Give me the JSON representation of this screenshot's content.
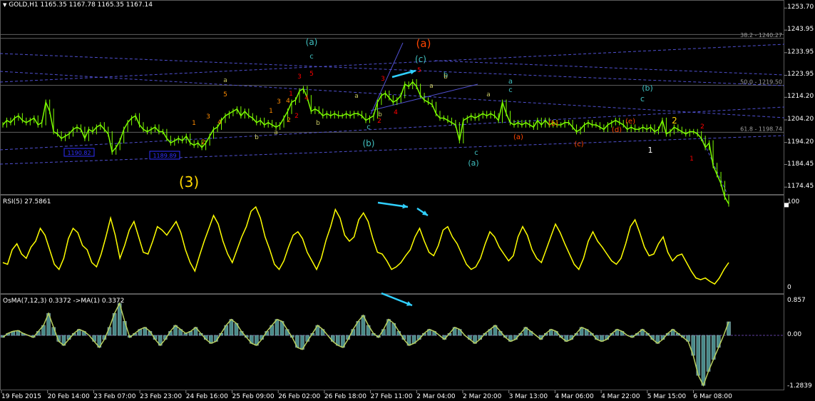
{
  "header": {
    "symbol": "GOLD,H1",
    "ohlc": "1165.35 1167.78 1165.35 1167.14",
    "rsi_label": "RSI(5) 27.5861",
    "osma_label": "OsMA(7,12,3) 0.3372 ->MA(1) 0.3372"
  },
  "chart_data": [
    {
      "type": "line",
      "title": "GOLD,H1",
      "ylim": [
        1172.0,
        1256.0
      ],
      "y_ticks": [
        "1253.70",
        "1243.95",
        "1233.95",
        "1223.95",
        "1214.20",
        "1204.20",
        "1194.20",
        "1184.45",
        "1174.45"
      ],
      "x_ticks": [
        "19 Feb 2015",
        "20 Feb 14:00",
        "23 Feb 07:00",
        "23 Feb 23:00",
        "24 Feb 16:00",
        "25 Feb 09:00",
        "26 Feb 02:00",
        "26 Feb 18:00",
        "27 Feb 11:00",
        "2 Mar 04:00",
        "2 Mar 20:00",
        "3 Mar 13:00",
        "4 Mar 06:00",
        "4 Mar 22:00",
        "5 Mar 15:00",
        "6 Mar 08:00"
      ],
      "series": [
        {
          "values": [
            1202,
            1204,
            1203,
            1205,
            1206,
            1204,
            1203,
            1204,
            1205,
            1202,
            1203,
            1212,
            1208,
            1199,
            1198,
            1196,
            1197,
            1198,
            1200,
            1201,
            1200,
            1196,
            1200,
            1199,
            1201,
            1202,
            1200,
            1198,
            1190,
            1192,
            1195,
            1200,
            1203,
            1205,
            1206,
            1202,
            1200,
            1199,
            1200,
            1201,
            1199,
            1199,
            1196,
            1194,
            1195,
            1196,
            1195,
            1197,
            1194,
            1193,
            1194,
            1192,
            1194,
            1197,
            1200,
            1201,
            1204,
            1206,
            1207,
            1208,
            1209,
            1206,
            1208,
            1206,
            1205,
            1203,
            1204,
            1202,
            1203,
            1202,
            1201,
            1202,
            1205,
            1208,
            1212,
            1213,
            1217,
            1218,
            1214,
            1208,
            1209,
            1208,
            1206,
            1207,
            1206,
            1207,
            1206,
            1206,
            1207,
            1206,
            1207,
            1207,
            1206,
            1204,
            1205,
            1206,
            1212,
            1215,
            1216,
            1214,
            1212,
            1213,
            1215,
            1220,
            1219,
            1221,
            1219,
            1215,
            1213,
            1212,
            1211,
            1207,
            1205,
            1205,
            1204,
            1203,
            1202,
            1195,
            1204,
            1205,
            1206,
            1205,
            1206,
            1207,
            1206,
            1207,
            1206,
            1204,
            1212,
            1207,
            1203,
            1202,
            1203,
            1202,
            1203,
            1202,
            1201,
            1204,
            1202,
            1204,
            1202,
            1203,
            1202,
            1202,
            1203,
            1203,
            1201,
            1199,
            1200,
            1202,
            1203,
            1202,
            1202,
            1201,
            1200,
            1202,
            1203,
            1204,
            1203,
            1202,
            1200,
            1201,
            1200,
            1200,
            1201,
            1200,
            1201,
            1199,
            1200,
            1204,
            1198,
            1199,
            1201,
            1200,
            1199,
            1198,
            1199,
            1199,
            1198,
            1196,
            1192,
            1194,
            1184,
            1180,
            1176,
            1170,
            1167
          ],
          "color": "#7cfc00"
        }
      ],
      "levels": [
        {
          "label": "38.2 - 1240.27",
          "value": 1240.27
        },
        {
          "label": "50.0 - 1219.50",
          "value": 1219.5
        },
        {
          "label": "61.8 - 1198.74",
          "value": 1198.74
        }
      ],
      "price_tags": [
        "1190.82",
        "1189.89"
      ],
      "wave_labels": [
        {
          "text": "(3)",
          "color": "#ffd700"
        },
        {
          "text": "(a)",
          "color": "#ff4500"
        },
        {
          "text": "(a)",
          "color": "#40c0c0"
        },
        {
          "text": "(c)",
          "color": "#40c0c0"
        },
        {
          "text": "(b)",
          "color": "#40c0c0"
        },
        {
          "text": "(a)",
          "color": "#40c0c0"
        },
        {
          "text": "(b)",
          "color": "#40c0c0"
        },
        {
          "text": "a",
          "color": "#40c0c0"
        },
        {
          "text": "c",
          "color": "#40c0c0"
        },
        {
          "text": "c",
          "color": "#40c0c0"
        },
        {
          "text": "c",
          "color": "#40c0c0"
        },
        {
          "text": "c",
          "color": "#40c0c0"
        },
        {
          "text": "c",
          "color": "#40c0c0"
        },
        {
          "text": "b",
          "color": "#40c0c0"
        },
        {
          "text": "(b)",
          "color": "#ff4500"
        },
        {
          "text": "(d)",
          "color": "#ff4500"
        },
        {
          "text": "(a)",
          "color": "#ff4500"
        },
        {
          "text": "(c)",
          "color": "#ff4500"
        },
        {
          "text": "(e)",
          "color": "#ff4500"
        },
        {
          "text": "1",
          "color": "#ffffff"
        },
        {
          "text": "2",
          "color": "#ffd700"
        },
        {
          "text": "2",
          "color": "#ff0000"
        },
        {
          "text": "1",
          "color": "#ff0000"
        },
        {
          "text": "1",
          "color": "#ff8c00"
        },
        {
          "text": "2",
          "color": "#ff8c00"
        },
        {
          "text": "3",
          "color": "#ff8c00"
        },
        {
          "text": "4",
          "color": "#ff8c00"
        },
        {
          "text": "5",
          "color": "#ff8c00"
        },
        {
          "text": "1",
          "color": "#ff8c00"
        },
        {
          "text": "2",
          "color": "#ff8c00"
        },
        {
          "text": "3",
          "color": "#ff8c00"
        },
        {
          "text": "4",
          "color": "#ff8c00"
        },
        {
          "text": "1",
          "color": "#ff0000"
        },
        {
          "text": "2",
          "color": "#ff0000"
        },
        {
          "text": "3",
          "color": "#ff0000"
        },
        {
          "text": "4",
          "color": "#ff0000"
        },
        {
          "text": "5",
          "color": "#ff0000"
        },
        {
          "text": "2",
          "color": "#ff0000"
        },
        {
          "text": "3",
          "color": "#ff0000"
        },
        {
          "text": "4",
          "color": "#ff0000"
        },
        {
          "text": "5",
          "color": "#ff0000"
        },
        {
          "text": "a",
          "color": "#c8c864"
        },
        {
          "text": "b",
          "color": "#c8c864"
        },
        {
          "text": "a",
          "color": "#c8c864"
        },
        {
          "text": "b",
          "color": "#c8c864"
        },
        {
          "text": "a",
          "color": "#c8c864"
        },
        {
          "text": "b",
          "color": "#c8c864"
        },
        {
          "text": "a",
          "color": "#c8c864"
        },
        {
          "text": "b",
          "color": "#c8c864"
        },
        {
          "text": "a",
          "color": "#c8c864"
        }
      ]
    },
    {
      "type": "line",
      "title": "RSI(5) 27.5861",
      "ylim": [
        0,
        100
      ],
      "y_ticks": [
        "100",
        "0"
      ],
      "series": [
        {
          "values": [
            30,
            28,
            45,
            52,
            40,
            35,
            48,
            55,
            70,
            62,
            45,
            28,
            22,
            35,
            58,
            70,
            65,
            50,
            45,
            30,
            25,
            40,
            60,
            82,
            62,
            35,
            50,
            68,
            78,
            60,
            42,
            40,
            55,
            72,
            68,
            62,
            70,
            78,
            65,
            45,
            30,
            20,
            38,
            55,
            70,
            85,
            75,
            55,
            40,
            30,
            45,
            60,
            72,
            90,
            95,
            82,
            60,
            45,
            28,
            22,
            32,
            48,
            62,
            66,
            58,
            42,
            32,
            22,
            35,
            56,
            72,
            92,
            82,
            62,
            55,
            60,
            80,
            88,
            78,
            58,
            42,
            40,
            32,
            22,
            25,
            30,
            38,
            45,
            60,
            70,
            55,
            42,
            38,
            50,
            68,
            72,
            60,
            52,
            40,
            28,
            22,
            25,
            35,
            52,
            66,
            60,
            48,
            40,
            32,
            38,
            60,
            72,
            62,
            45,
            35,
            30,
            45,
            60,
            75,
            65,
            52,
            40,
            28,
            22,
            35,
            55,
            66,
            55,
            48,
            40,
            32,
            28,
            35,
            52,
            72,
            80,
            65,
            48,
            38,
            40,
            52,
            60,
            42,
            32,
            38,
            40,
            30,
            20,
            12,
            10,
            12,
            8,
            5,
            12,
            22,
            30
          ],
          "color": "#ffff00"
        }
      ]
    },
    {
      "type": "bar",
      "title": "OsMA(7,12,3) 0.3372 ->MA(1) 0.3372",
      "ylim": [
        -1.2839,
        0.857
      ],
      "y_ticks": [
        "0.857",
        "0.00",
        "-1.2839"
      ],
      "series": [
        {
          "values": [
            -0.05,
            0.05,
            0.1,
            0.12,
            0.05,
            0.0,
            -0.05,
            0.1,
            0.25,
            0.55,
            0.2,
            -0.15,
            -0.25,
            -0.1,
            0.05,
            0.15,
            0.1,
            0.0,
            -0.15,
            -0.3,
            -0.1,
            0.2,
            0.55,
            0.8,
            0.35,
            -0.05,
            0.05,
            0.15,
            0.2,
            0.1,
            -0.1,
            -0.25,
            -0.1,
            0.1,
            0.25,
            0.15,
            0.05,
            0.1,
            0.2,
            0.05,
            -0.1,
            -0.2,
            -0.15,
            0.05,
            0.25,
            0.4,
            0.3,
            0.1,
            -0.05,
            -0.2,
            -0.25,
            -0.1,
            0.1,
            0.25,
            0.4,
            0.35,
            0.15,
            -0.05,
            -0.3,
            -0.35,
            -0.15,
            0.05,
            0.25,
            0.15,
            0.0,
            -0.15,
            -0.25,
            -0.3,
            -0.1,
            0.15,
            0.35,
            0.5,
            0.25,
            0.05,
            -0.05,
            0.15,
            0.4,
            0.3,
            0.1,
            -0.1,
            -0.25,
            -0.2,
            -0.1,
            0.05,
            0.15,
            0.1,
            0.0,
            -0.1,
            0.05,
            0.2,
            0.15,
            0.0,
            -0.1,
            -0.2,
            -0.1,
            0.05,
            0.15,
            0.25,
            0.1,
            -0.05,
            -0.15,
            -0.1,
            0.05,
            0.2,
            0.1,
            0.0,
            -0.1,
            0.05,
            0.15,
            0.1,
            -0.05,
            -0.15,
            -0.1,
            0.05,
            0.2,
            0.15,
            0.05,
            -0.1,
            -0.15,
            -0.1,
            0.05,
            0.15,
            0.1,
            0.0,
            -0.05,
            0.05,
            0.15,
            0.05,
            -0.1,
            -0.2,
            -0.1,
            0.05,
            0.15,
            0.05,
            -0.05,
            -0.15,
            -0.5,
            -1.0,
            -1.25,
            -0.9,
            -0.6,
            -0.3,
            0.0,
            0.34
          ],
          "color": "#66aaaa"
        }
      ]
    }
  ]
}
